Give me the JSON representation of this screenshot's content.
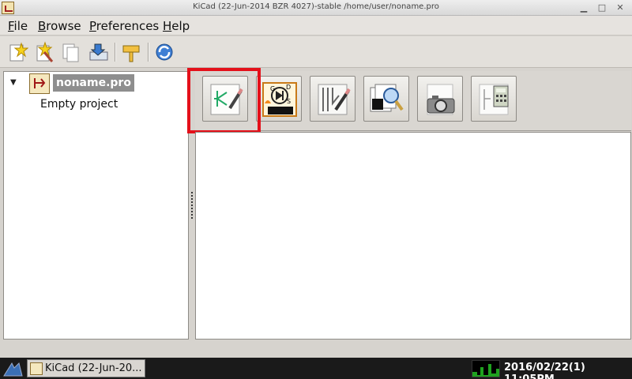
{
  "window": {
    "title": "KiCad (22-Jun-2014 BZR 4027)-stable /home/user/noname.pro",
    "controls": [
      "minimize-icon",
      "maximize-icon",
      "close-icon"
    ]
  },
  "menu": {
    "file": "File",
    "browse": "Browse",
    "preferences": "Preferences",
    "help": "Help"
  },
  "toolbar": {
    "icons": [
      "new-project-icon",
      "new-project-template-icon",
      "open-project-icon",
      "save-project-icon",
      "archive-icon",
      "refresh-icon"
    ]
  },
  "tree": {
    "project": "noname.pro",
    "child": "Empty project"
  },
  "launcher": {
    "icons": [
      "schematic-editor-icon",
      "component-library-editor-icon",
      "pcb-editor-icon",
      "gerber-viewer-icon",
      "bitmap-to-component-icon",
      "pcb-calculator-icon"
    ],
    "highlight_color": "#e4101a"
  },
  "taskbar": {
    "task_label": "KiCad (22-Jun-20...",
    "clock": "2016/02/22(1) 11:05PM"
  }
}
